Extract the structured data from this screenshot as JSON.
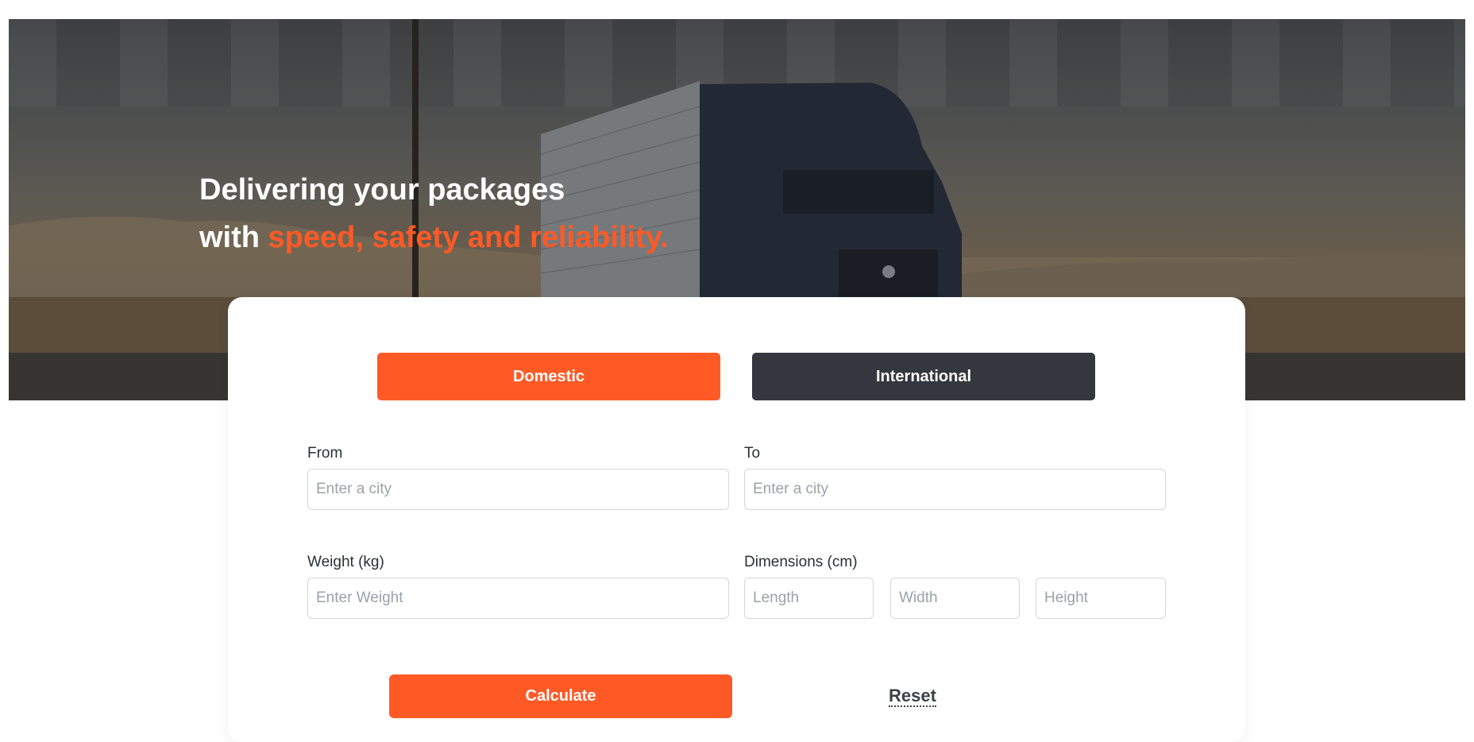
{
  "hero": {
    "headline_line1": "Delivering your packages",
    "headline_line2_prefix": "with ",
    "headline_line2_accent": "speed, safety and reliability.",
    "image": "truck-on-highway-background"
  },
  "tabs": {
    "domestic_label": "Domestic",
    "international_label": "International",
    "selected": "Domestic"
  },
  "form": {
    "from_label": "From",
    "from_placeholder": "Enter a city",
    "to_label": "To",
    "to_placeholder": "Enter a city",
    "weight_label": "Weight (kg)",
    "weight_placeholder": "Enter Weight",
    "dimensions_label": "Dimensions (cm)",
    "length_placeholder": "Length",
    "width_placeholder": "Width",
    "height_placeholder": "Height"
  },
  "actions": {
    "calculate_label": "Calculate",
    "reset_label": "Reset"
  },
  "colors": {
    "accent": "#ff5a26",
    "dark_button": "#34373d",
    "text": "#2b2f36",
    "placeholder": "#9ba1a8",
    "border": "#d3d6da"
  }
}
